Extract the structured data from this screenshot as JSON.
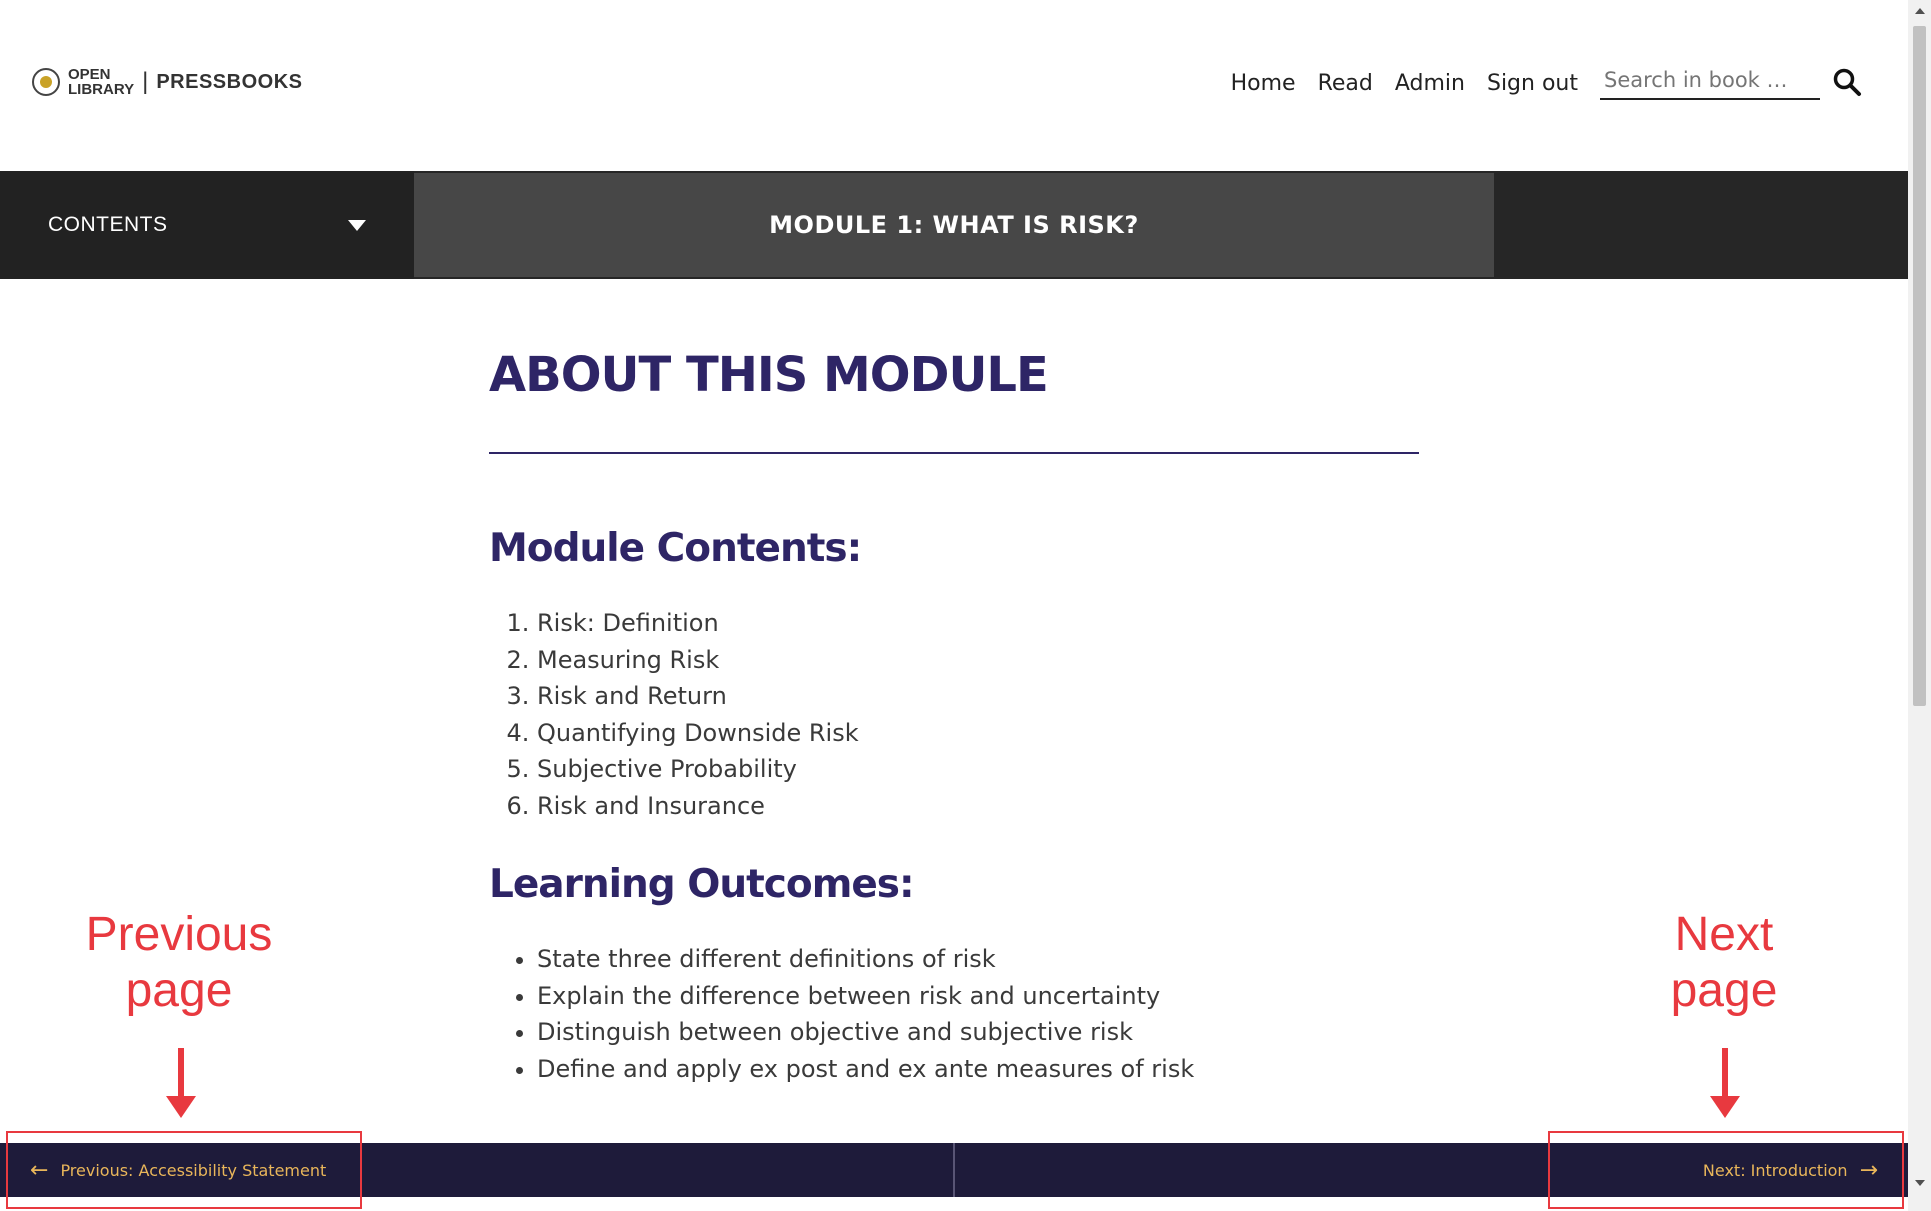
{
  "header": {
    "logo": {
      "line1": "OPEN",
      "line2": "LIBRARY",
      "separator": "|",
      "brand": "PRESSBOOKS",
      "icon": "open-library-seal-icon"
    },
    "nav": [
      "Home",
      "Read",
      "Admin",
      "Sign out"
    ],
    "search": {
      "placeholder": "Search in book …",
      "icon": "search-icon"
    }
  },
  "navbar": {
    "toc_label": "CONTENTS",
    "toc_icon": "caret-down-icon",
    "module_title": "MODULE 1: WHAT IS RISK?"
  },
  "content": {
    "title": "ABOUT THIS MODULE",
    "contents_heading": "Module Contents:",
    "contents_items": [
      "Risk: Definition",
      "Measuring Risk",
      "Risk and Return",
      "Quantifying Downside Risk",
      "Subjective Probability",
      "Risk and Insurance"
    ],
    "outcomes_heading": "Learning Outcomes:",
    "outcomes_items": [
      "State three different definitions of risk",
      "Explain the difference between risk and uncertainty",
      "Distinguish between objective and subjective risk",
      "Define and apply ex post and ex ante measures of risk"
    ]
  },
  "bottom_nav": {
    "prev_label": "Previous: Accessibility Statement",
    "next_label": "Next: Introduction",
    "prev_icon": "arrow-left-icon",
    "next_icon": "arrow-right-icon"
  },
  "annotations": {
    "prev_line1": "Previous",
    "prev_line2": "page",
    "next_line1": "Next",
    "next_line2": "page"
  },
  "colors": {
    "heading": "#2e2566",
    "navbar": "#262626",
    "module_bar": "#474747",
    "bottom_nav": "#1e1b3a",
    "nav_link": "#e9b65a",
    "annotation": "#e8393f"
  }
}
